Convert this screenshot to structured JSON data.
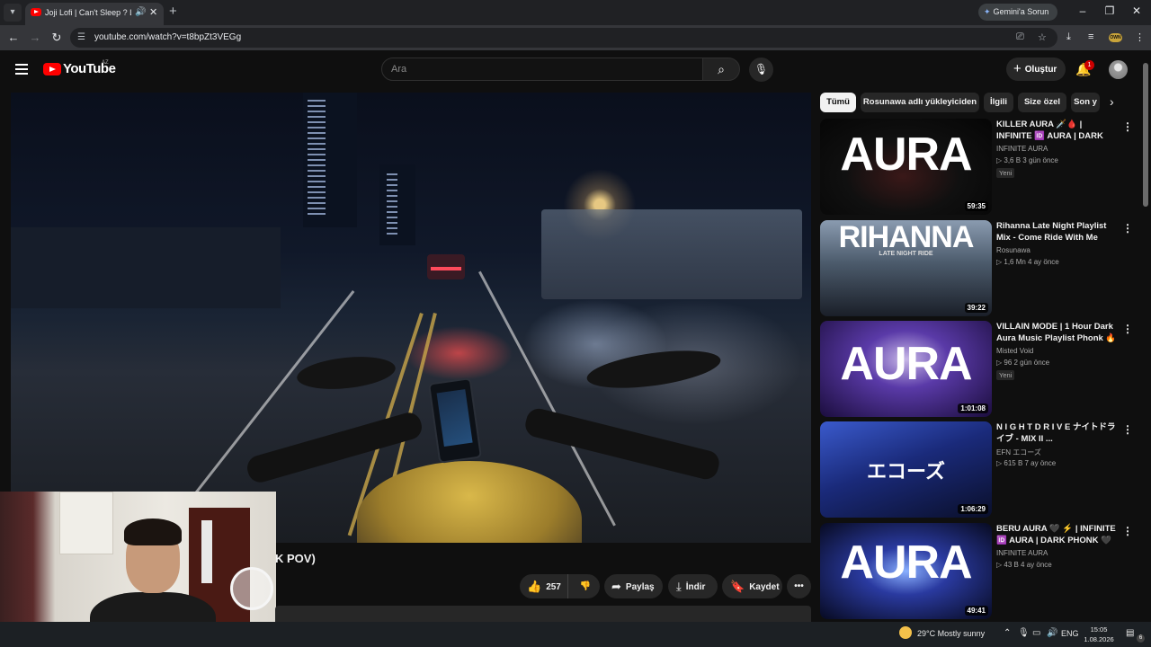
{
  "browser": {
    "tab_title": "Joji Lofi | Can't Sleep ? Late",
    "new_tab_icon": "plus-icon",
    "gemini_label": "Gemini'a Sorun",
    "url": "youtube.com/watch?v=t8bpZt3VEGg",
    "ext_label": "OWN"
  },
  "youtube": {
    "logo_text": "YouTube",
    "country_code": "AZ",
    "search_placeholder": "Ara",
    "create_label": "Oluştur",
    "notification_count": "1",
    "video_title_partial": "K POV)",
    "like_count": "257",
    "share_label": "Paylaş",
    "download_label": "İndir",
    "save_label": "Kaydet",
    "chips": [
      "Tümü",
      "Rosunawa adlı yükleyiciden",
      "İlgili",
      "Size özel",
      "Son y"
    ],
    "recommendations": [
      {
        "thumb_text": "AURA",
        "duration": "59:35",
        "title": "KILLER AURA 🗡️🩸 | INFINITE 🆔 AURA | DARK PHONK FOR ...",
        "channel": "INFINITE AURA",
        "meta": "▷ 3,6 B   3 gün önce",
        "badge": "Yeni"
      },
      {
        "thumb_text": "RIHANNA",
        "thumb_sub": "LATE NIGHT RIDE",
        "duration": "39:22",
        "title": "Rihanna Late Night Playlist Mix - Come Ride With Me",
        "channel": "Rosunawa",
        "meta": "▷ 1,6 Mn   4 ay önce",
        "badge": ""
      },
      {
        "thumb_text": "AURA",
        "duration": "1:01:08",
        "title": "VILLAIN MODE | 1 Hour Dark Aura Music Playlist Phonk 🔥 ...",
        "channel": "Misted Void",
        "meta": "▷ 96   2 gün önce",
        "badge": "Yeni"
      },
      {
        "thumb_text": "エコーズ",
        "duration": "1:06:29",
        "title": "N I G H T D R I V E ナイトドライブ - MIX II ...",
        "channel": "EFN エコーズ",
        "meta": "▷ 615 B   7 ay önce",
        "badge": ""
      },
      {
        "thumb_text": "AURA",
        "duration": "49:41",
        "title": "BERU AURA 🖤 ⚡ | INFINITE 🆔 AURA | DARK PHONK 🖤 F...",
        "channel": "INFINITE AURA",
        "meta": "▷ 43 B   4 ay önce",
        "badge": ""
      }
    ]
  },
  "taskbar": {
    "weather": "29°C  Mostly sunny",
    "lang": "ENG",
    "time": "15:05",
    "date": "1.08.2026",
    "notif_count": "6"
  },
  "colors": {
    "yt_red": "#ff0000",
    "bg": "#0f0f0f",
    "chip": "#272727"
  }
}
